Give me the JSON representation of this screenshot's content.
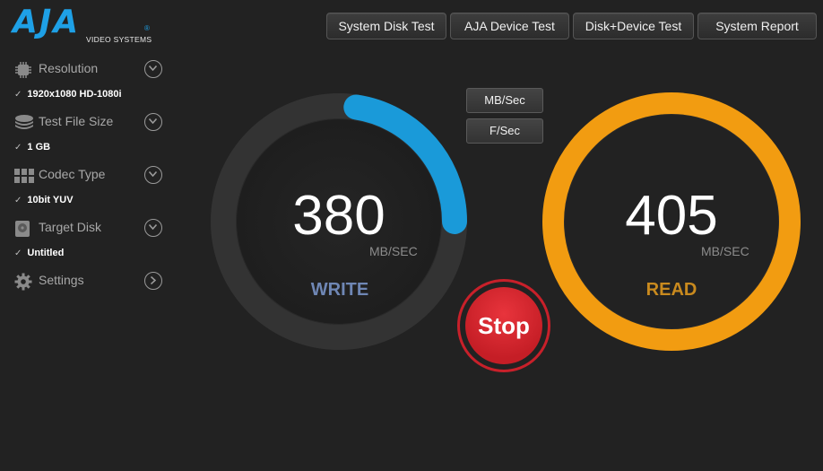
{
  "logo": {
    "name": "AJA",
    "subtitle": "VIDEO SYSTEMS",
    "reg": "®"
  },
  "toolbar": {
    "buttons": [
      {
        "label": "System Disk Test"
      },
      {
        "label": "AJA Device Test"
      },
      {
        "label": "Disk+Device Test"
      },
      {
        "label": "System Report"
      }
    ]
  },
  "sidebar": {
    "items": [
      {
        "label": "Resolution",
        "value": "1920x1080 HD-1080i",
        "icon": "resolution-chip-icon",
        "expand": "chevron-down-icon"
      },
      {
        "label": "Test File Size",
        "value": "1 GB",
        "icon": "stack-icon",
        "expand": "chevron-down-icon"
      },
      {
        "label": "Codec Type",
        "value": "10bit YUV",
        "icon": "codec-grid-icon",
        "expand": "chevron-down-icon"
      },
      {
        "label": "Target Disk",
        "value": "Untitled",
        "icon": "disk-icon",
        "expand": "chevron-down-icon"
      },
      {
        "label": "Settings",
        "value": null,
        "icon": "gear-icon",
        "expand": "chevron-right-icon"
      }
    ],
    "check": "✓"
  },
  "units": {
    "mbsec": "MB/Sec",
    "fsec": "F/Sec"
  },
  "write": {
    "value": "380",
    "unit": "MB/SEC",
    "label": "WRITE",
    "progress": 0.25,
    "color": "#1a9ad9",
    "label_color": "#6f87b5"
  },
  "read": {
    "value": "405",
    "unit": "MB/SEC",
    "label": "READ",
    "progress": 1.0,
    "color": "#f29c11",
    "label_color": "#c98a1e"
  },
  "stop": {
    "label": "Stop",
    "color": "#d8262e"
  }
}
